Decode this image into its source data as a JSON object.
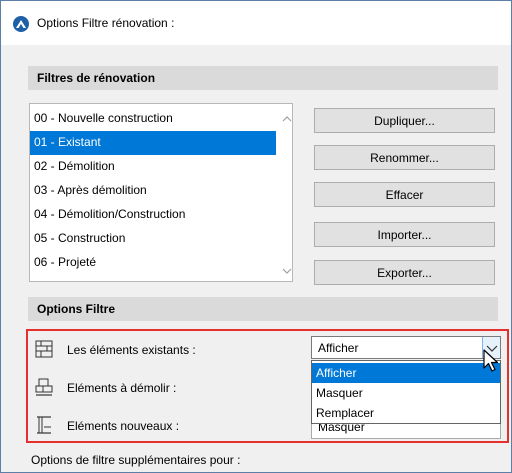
{
  "window": {
    "title": "Options Filtre rénovation :"
  },
  "filters_section": {
    "header": "Filtres de rénovation"
  },
  "filters": [
    "00 - Nouvelle construction",
    "01 - Existant",
    "02 - Démolition",
    "03 - Après démolition",
    "04 - Démolition/Construction",
    "05 - Construction",
    "06 - Projeté"
  ],
  "selected_filter_index": 1,
  "buttons": {
    "duplicate": "Dupliquer...",
    "rename": "Renommer...",
    "delete": "Effacer",
    "import": "Importer...",
    "export": "Exporter..."
  },
  "options_section": {
    "header": "Options Filtre"
  },
  "options": {
    "existing_label": "Les éléments existants :",
    "existing_value": "Afficher",
    "demolish_label": "Eléments à démolir :",
    "new_label": "Eléments nouveaux :",
    "new_value": "Masquer"
  },
  "dropdown": {
    "items": [
      "Afficher",
      "Masquer",
      "Remplacer"
    ],
    "selected_index": 0
  },
  "footer": {
    "text": "Options de filtre supplémentaires pour :"
  },
  "colors": {
    "selection": "#0078d7",
    "highlight_border": "#e53030",
    "section_header": "#dadada"
  }
}
